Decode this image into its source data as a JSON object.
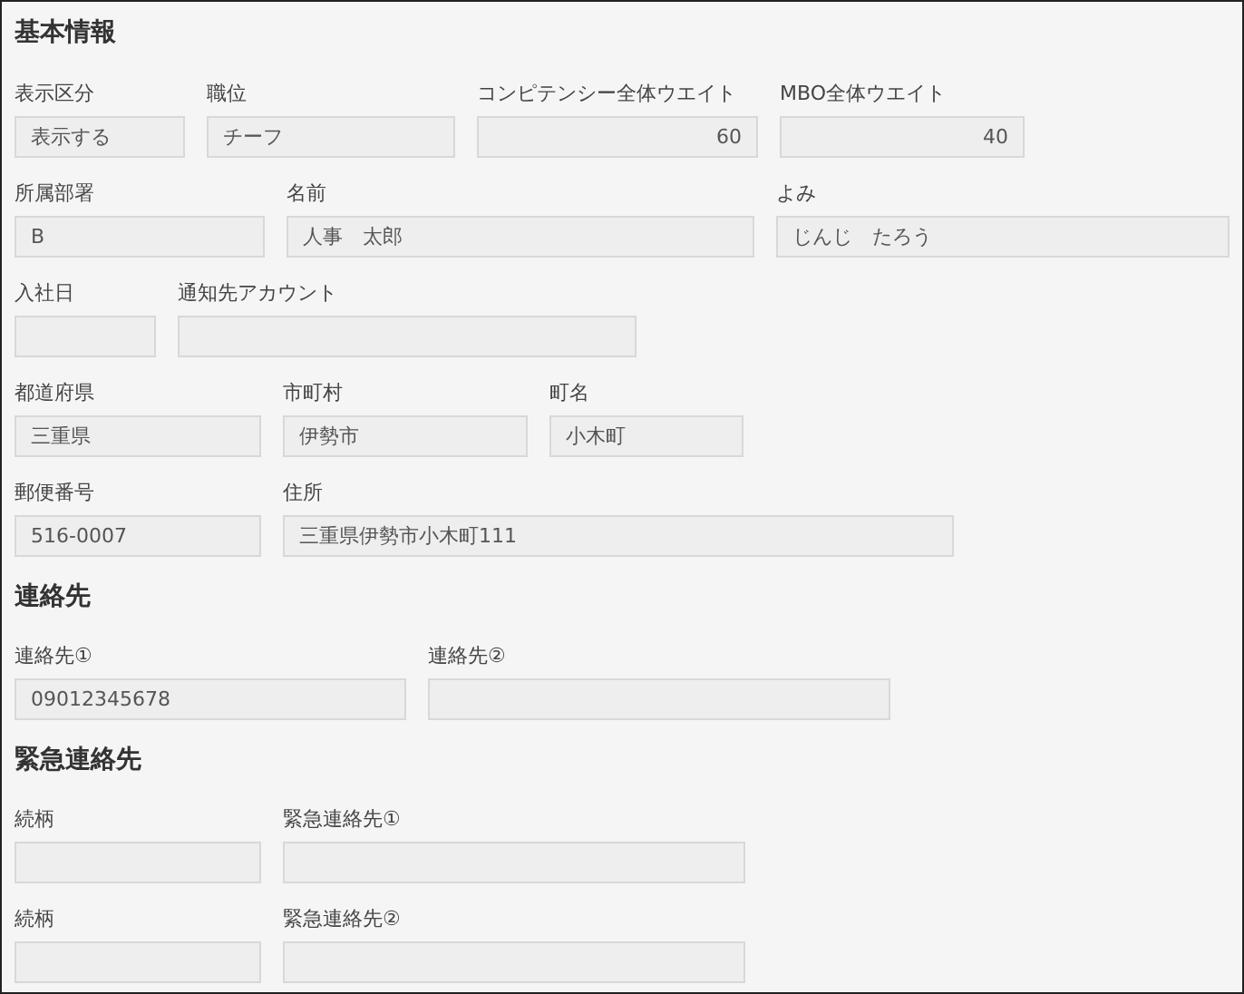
{
  "sections": [
    {
      "title": "基本情報",
      "rows": [
        {
          "fields": [
            {
              "label": "表示区分",
              "value": "表示する",
              "kind": "text"
            },
            {
              "label": "職位",
              "value": "チーフ",
              "kind": "text"
            },
            {
              "label": "コンピテンシー全体ウエイト",
              "value": "60",
              "kind": "number"
            },
            {
              "label": "MBO全体ウエイト",
              "value": "40",
              "kind": "number"
            }
          ]
        },
        {
          "fields": [
            {
              "label": "所属部署",
              "value": "B",
              "kind": "text"
            },
            {
              "label": "名前",
              "value": "人事　太郎",
              "kind": "text"
            },
            {
              "label": "よみ",
              "value": "じんじ　たろう",
              "kind": "text"
            }
          ]
        },
        {
          "fields": [
            {
              "label": "入社日",
              "kind": "text"
            },
            {
              "label": "通知先アカウント",
              "kind": "text"
            }
          ]
        },
        {
          "fields": [
            {
              "label": "都道府県",
              "value": "三重県",
              "kind": "text"
            },
            {
              "label": "市町村",
              "value": "伊勢市",
              "kind": "text"
            },
            {
              "label": "町名",
              "value": "小木町",
              "kind": "text"
            }
          ]
        },
        {
          "fields": [
            {
              "label": "郵便番号",
              "value": "516-0007",
              "kind": "text"
            },
            {
              "label": "住所",
              "value": "三重県伊勢市小木町111",
              "kind": "text"
            }
          ]
        }
      ]
    },
    {
      "title": "連絡先",
      "rows": [
        {
          "fields": [
            {
              "label": "連絡先①",
              "value": "09012345678",
              "kind": "text"
            },
            {
              "label": "連絡先②",
              "kind": "text"
            }
          ]
        }
      ]
    },
    {
      "title": "緊急連絡先",
      "rows": [
        {
          "fields": [
            {
              "label": "続柄",
              "kind": "text"
            },
            {
              "label": "緊急連絡先①",
              "kind": "text"
            }
          ]
        },
        {
          "fields": [
            {
              "label": "続柄",
              "kind": "text"
            },
            {
              "label": "緊急連絡先②",
              "kind": "text"
            }
          ]
        }
      ]
    }
  ]
}
